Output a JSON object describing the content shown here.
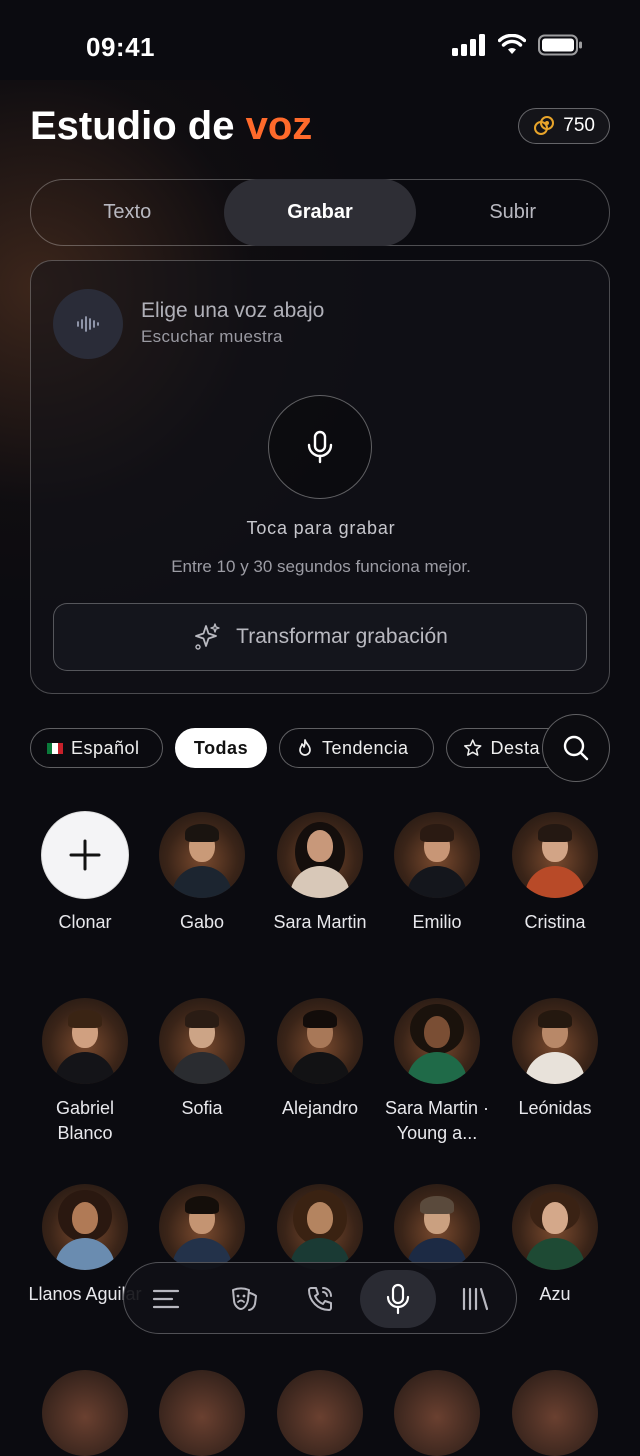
{
  "status_bar": {
    "time": "09:41"
  },
  "header": {
    "title_prefix": "Estudio de",
    "title_accent": "voz",
    "credits": "750"
  },
  "mode_tabs": [
    {
      "label": "Texto",
      "active": false
    },
    {
      "label": "Grabar",
      "active": true
    },
    {
      "label": "Subir",
      "active": false
    }
  ],
  "record_card": {
    "voice_title": "Elige una voz abajo",
    "voice_subtitle": "Escuchar muestra",
    "tap_label": "Toca para grabar",
    "hint": "Entre 10 y 30 segundos funciona mejor.",
    "transform_label": "Transformar grabación"
  },
  "filters": {
    "language": "Español",
    "all": "Todas",
    "trending": "Tendencia",
    "featured": "Desta"
  },
  "voices": [
    {
      "name": "Clonar",
      "type": "add"
    },
    {
      "name": "Gabo"
    },
    {
      "name": "Sara Martin"
    },
    {
      "name": "Emilio"
    },
    {
      "name": "Cristina"
    },
    {
      "name": "Gabriel Blanco"
    },
    {
      "name": "Sofia"
    },
    {
      "name": "Alejandro"
    },
    {
      "name": "Sara Martin · Young a..."
    },
    {
      "name": "Leónidas"
    },
    {
      "name": "Llanos Aguilar"
    },
    {
      "name": ""
    },
    {
      "name": ""
    },
    {
      "name": ""
    },
    {
      "name": "Azu"
    }
  ],
  "colors": {
    "accent": "#ff6a2b",
    "background": "#0b0b10"
  },
  "bottom_nav": [
    "menu-icon",
    "theater-mask-icon",
    "phone-wave-icon",
    "microphone-icon",
    "library-icon"
  ]
}
